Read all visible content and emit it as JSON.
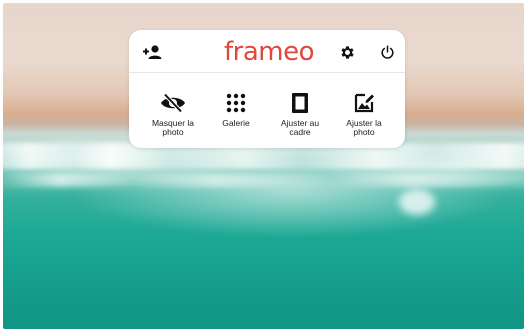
{
  "app": {
    "logo_text": "frameo"
  },
  "topbar": {
    "add_friend_icon": "person-add-icon",
    "settings_icon": "gear-icon",
    "power_icon": "power-icon"
  },
  "actions": [
    {
      "label": "Masquer la\nphoto",
      "icon": "eye-off-icon"
    },
    {
      "label": "Galerie",
      "icon": "grid-icon"
    },
    {
      "label": "Ajuster au\ncadre",
      "icon": "fit-frame-icon"
    },
    {
      "label": "Ajuster la\nphoto",
      "icon": "edit-photo-icon"
    }
  ],
  "colors": {
    "brand": "#e0473f",
    "panel": "#ffffff",
    "icon": "#111111"
  }
}
